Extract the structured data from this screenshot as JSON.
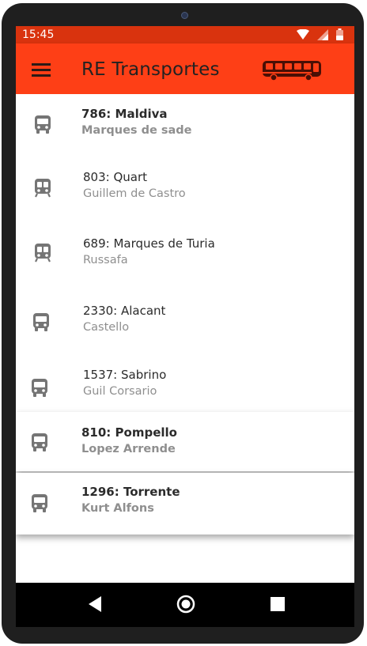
{
  "status_bar": {
    "time": "15:45",
    "icons": [
      "wifi-icon",
      "signal-icon",
      "battery-icon"
    ]
  },
  "app_bar": {
    "title": "RE Transportes",
    "menu_icon": "hamburger-menu-icon",
    "logo_icon": "bus-icon"
  },
  "routes": [
    {
      "title": "786: Maldiva",
      "subtitle": "Marques de sade",
      "icon": "bus-icon"
    },
    {
      "title": "803: Quart",
      "subtitle": "Guillem de Castro",
      "icon": "tram-icon"
    },
    {
      "title": "689: Marques de Turia",
      "subtitle": "Russafa",
      "icon": "tram-icon"
    },
    {
      "title": "2330: Alacant",
      "subtitle": "Castello",
      "icon": "bus-icon"
    },
    {
      "title": "1537: Sabrino",
      "subtitle": "Guil Corsario",
      "icon": "bus-icon"
    },
    {
      "title": "810: Pompello",
      "subtitle": "Lopez Arrende",
      "icon": "bus-icon"
    },
    {
      "title": "1296: Torrente",
      "subtitle": "Kurt Alfons",
      "icon": "bus-icon"
    }
  ],
  "nav_bar": {
    "buttons": [
      "back-icon",
      "home-icon",
      "recents-icon"
    ]
  },
  "colors": {
    "app_bar": "#fe3f16",
    "status_bar": "#d9330e",
    "icon_gray": "#757575",
    "subtitle_gray": "#8f8f8f"
  }
}
